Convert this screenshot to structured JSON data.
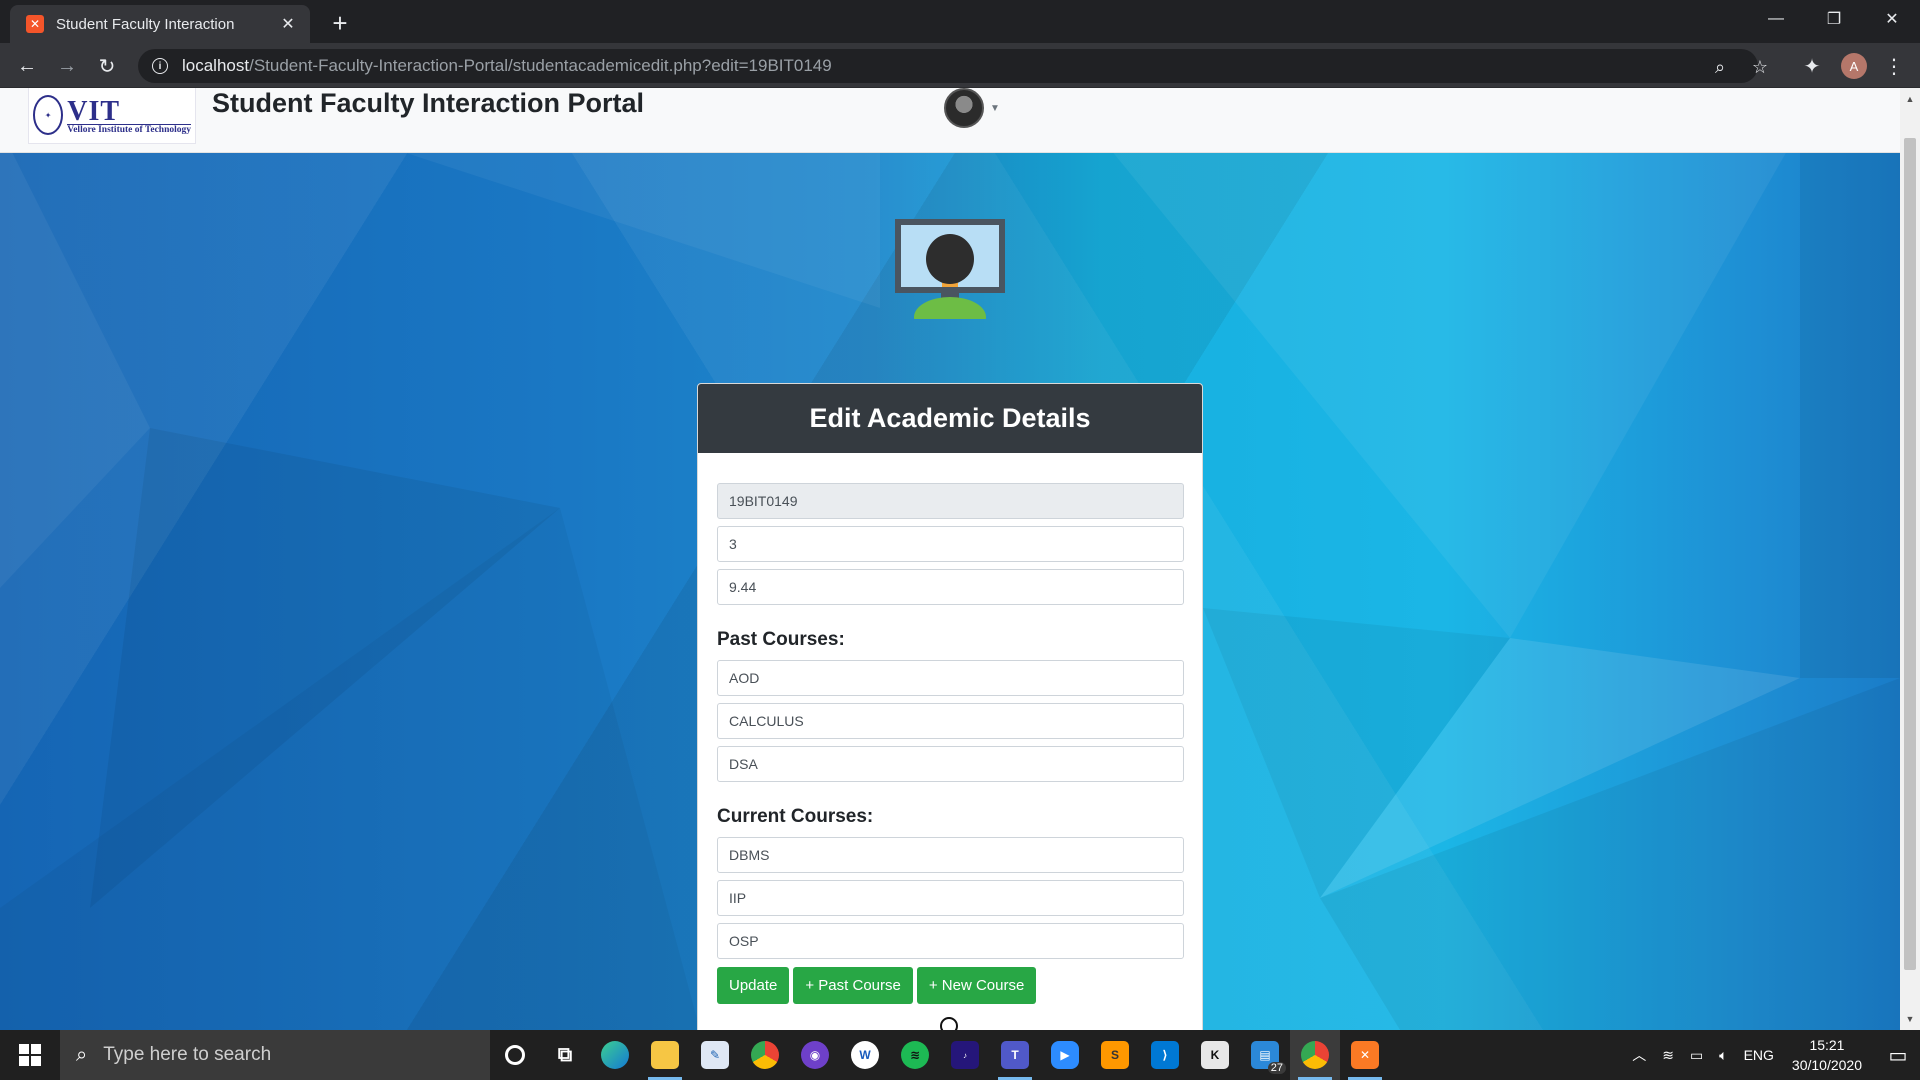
{
  "browser": {
    "tab_title": "Student Faculty Interaction",
    "url_host": "localhost",
    "url_path": "/Student-Faculty-Interaction-Portal/studentacademicedit.php?edit=19BIT0149",
    "profile_initial": "A"
  },
  "header": {
    "logo_text": "VIT",
    "logo_subtext": "Vellore Institute of Technology",
    "title": "Student Faculty Interaction Portal"
  },
  "form": {
    "heading": "Edit Academic Details",
    "reg_no": "19BIT0149",
    "semester": "3",
    "cgpa": "9.44",
    "past_label": "Past Courses:",
    "past_courses": [
      "AOD",
      "CALCULUS",
      "DSA"
    ],
    "current_label": "Current Courses:",
    "current_courses": [
      "DBMS",
      "IIP",
      "OSP"
    ],
    "buttons": {
      "update": "Update",
      "past_course": "+ Past Course",
      "new_course": "+ New Course"
    }
  },
  "taskbar": {
    "search_placeholder": "Type here to search",
    "time": "15:21",
    "date": "30/10/2020",
    "language": "ENG",
    "badge_count": "27"
  },
  "colors": {
    "accent_green": "#28a745",
    "card_header": "#343a40",
    "bg_blue": "#1a78c4"
  }
}
